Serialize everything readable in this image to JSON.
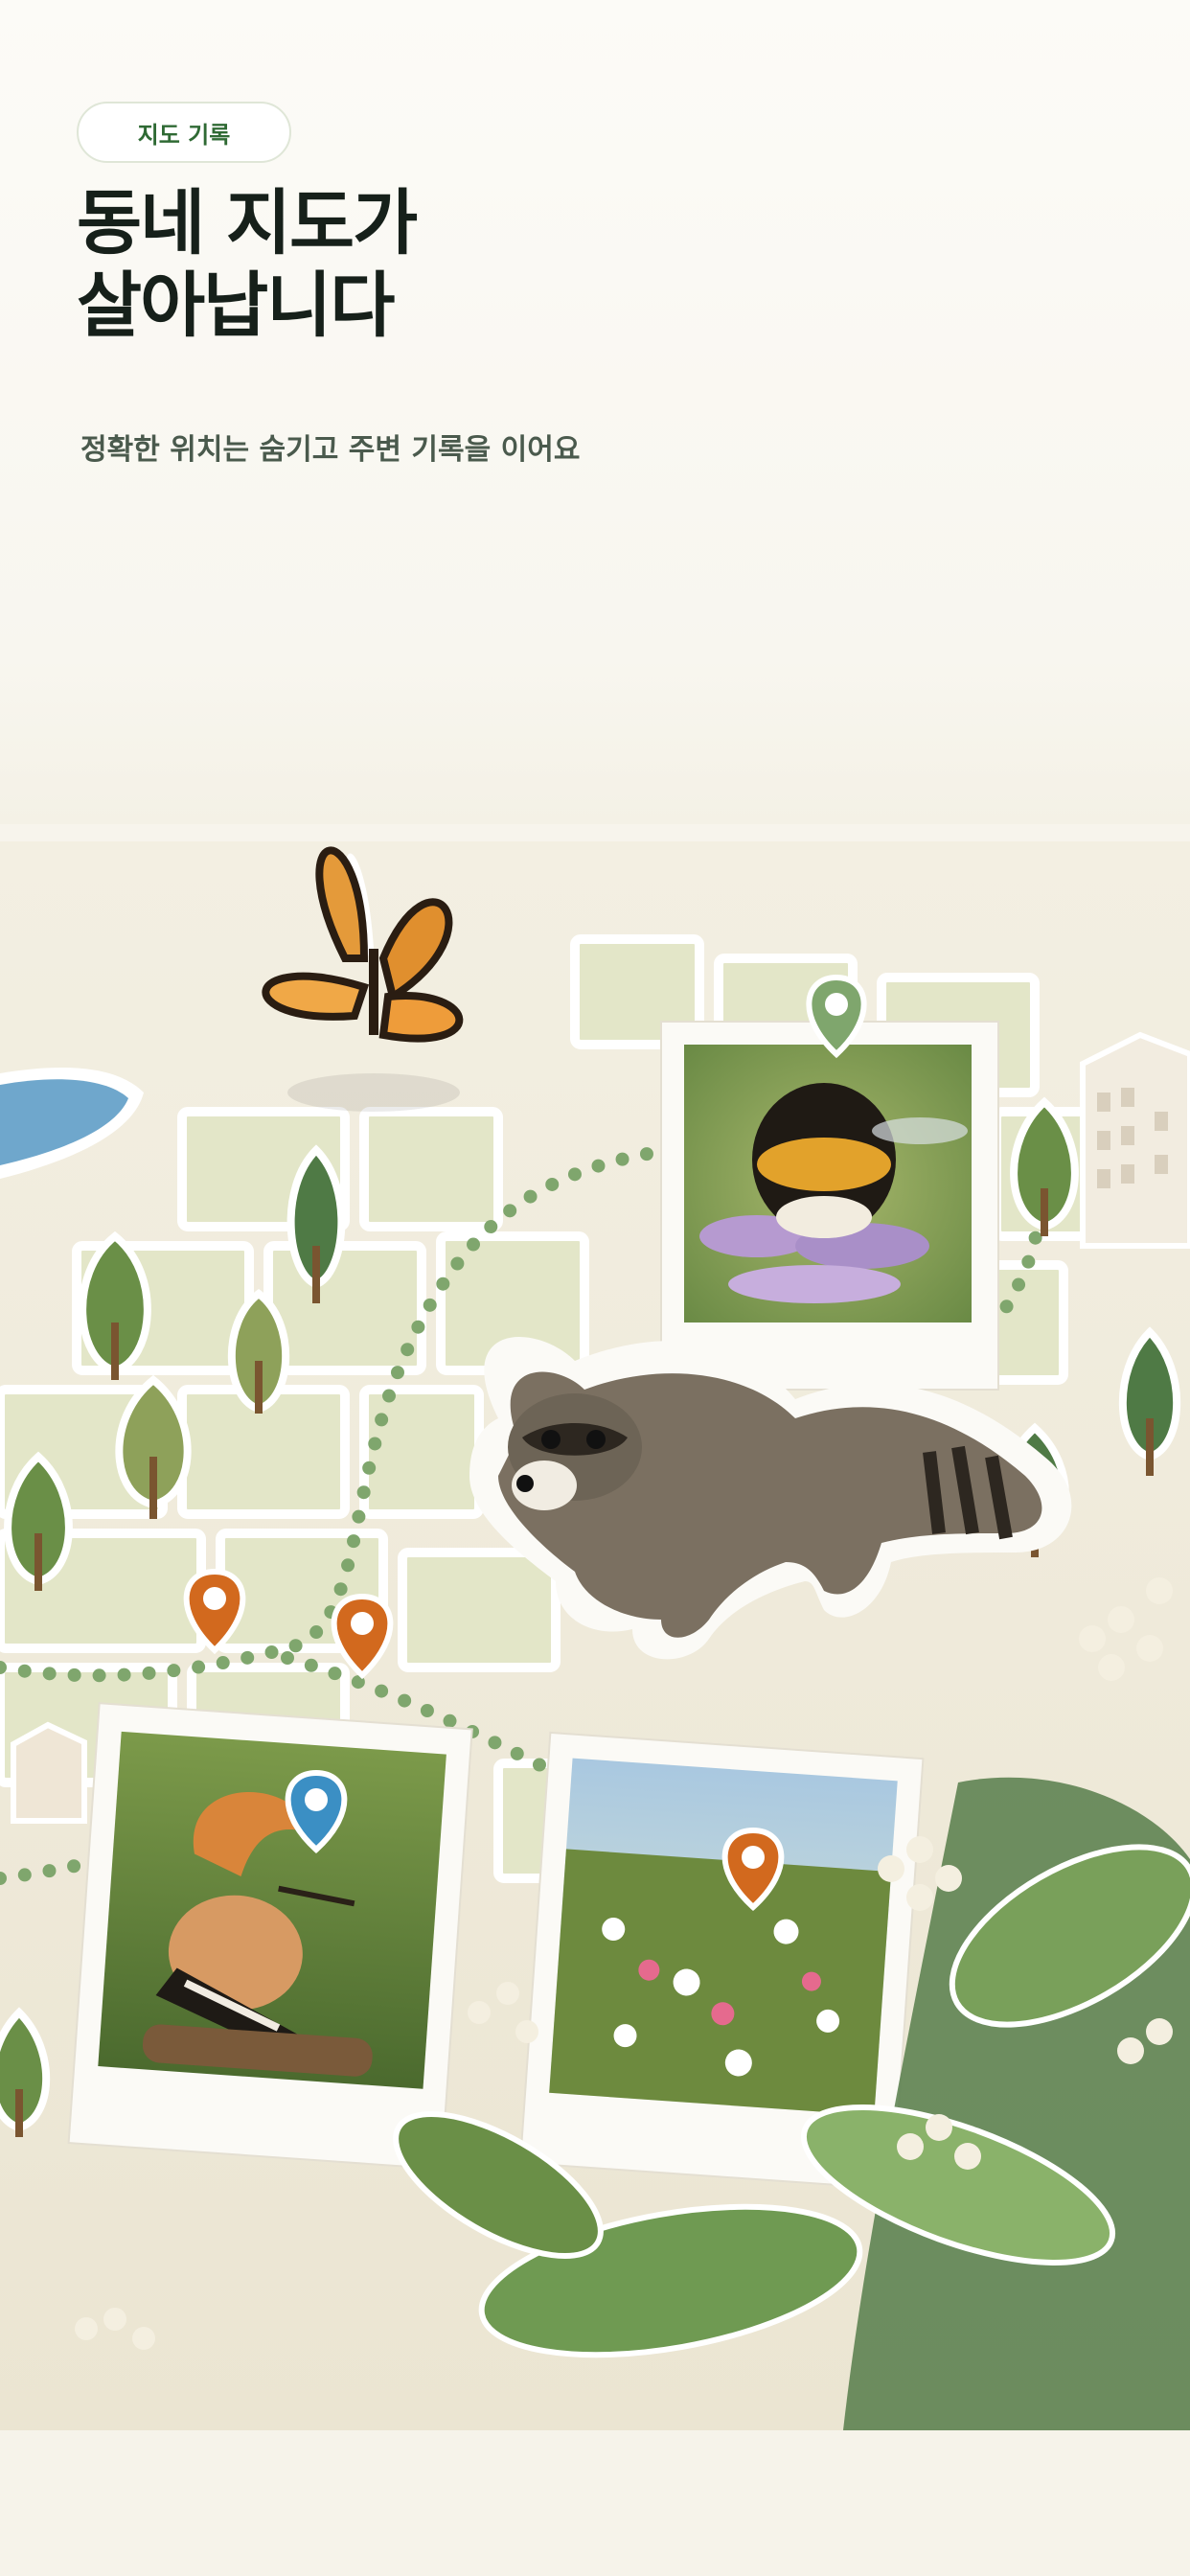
{
  "header": {
    "badge": "지도 기록",
    "title_line1": "동네 지도가",
    "title_line2": "살아납니다",
    "subtitle": "정확한 위치는 숨기고 주변 기록을 이어요"
  },
  "illustration": {
    "pin_colors": {
      "green": "#7fa66d",
      "orange": "#d2691e",
      "blue": "#3b8fc4"
    },
    "map_background": "#efe9d9",
    "water": "#6fa7cc"
  }
}
